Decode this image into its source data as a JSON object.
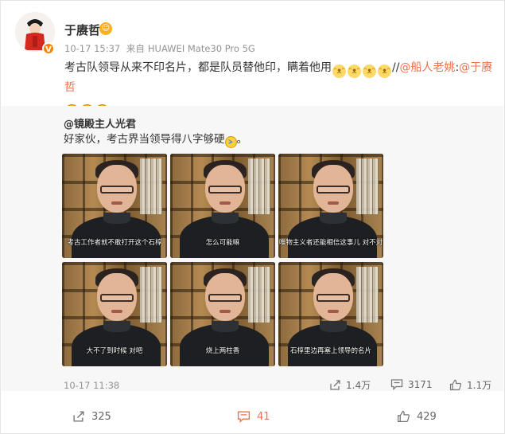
{
  "post": {
    "username": "于赓哲",
    "time": "10-17 15:37",
    "source_prefix": "来自",
    "source_device": "HUAWEI Mate30 Pro 5G",
    "text_main": "考古队领导从来不印名片，都是队员替他印，瞒着他用",
    "text_sep": "//",
    "mention_1": "@船人老姚",
    "colon": ":",
    "mention_2": "@于赓哲"
  },
  "repost": {
    "author": "@镜殿主人光君",
    "text": "好家伙，考古界当领导得八字够硬",
    "date": "10-17 11:38",
    "shares": "1.4万",
    "comments": "3171",
    "likes": "1.1万",
    "images": [
      {
        "subtitle": "考古工作者就不敢打开这个石椁"
      },
      {
        "subtitle": "怎么可能嘛"
      },
      {
        "subtitle": "唯物主义者还能相信这事儿 对不对"
      },
      {
        "subtitle": "大不了到时候 对吧"
      },
      {
        "subtitle": "烧上两柱香"
      },
      {
        "subtitle": "石椁里边再塞上领导的名片"
      }
    ]
  },
  "footer": {
    "shares": "325",
    "comments": "41",
    "likes": "429"
  },
  "icons": {
    "share": "share-icon",
    "comment": "comment-icon",
    "like": "thumbs-up-icon",
    "verified": "verified-badge-icon",
    "emoji_cat": "cat-face-emoji",
    "emoji_laugh": "laugh-emoji",
    "emoji_cry": "laugh-cry-emoji"
  },
  "colors": {
    "accent": "#eb7350",
    "meta_gray": "#939393",
    "repost_bg": "#f7f7f7"
  }
}
